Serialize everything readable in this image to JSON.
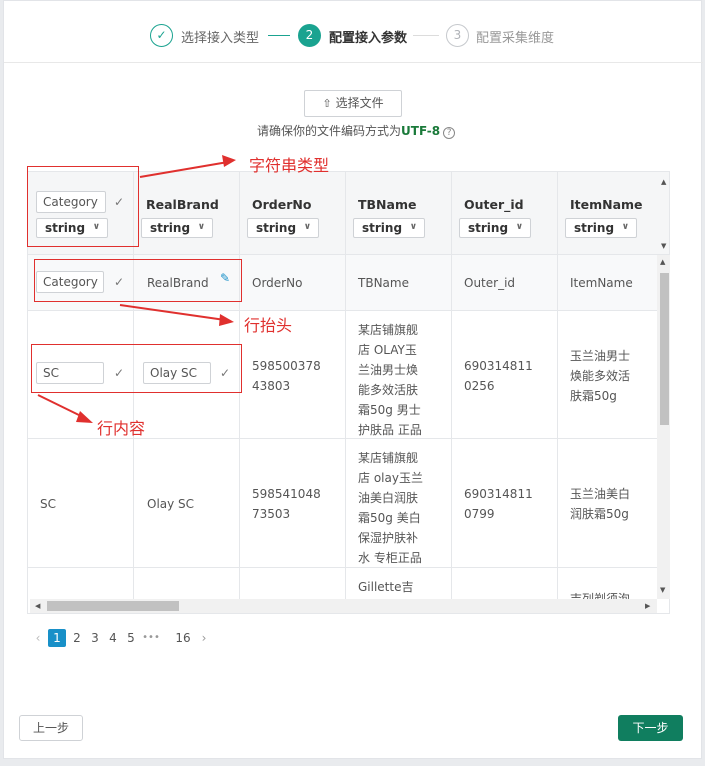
{
  "steps": [
    {
      "label": "选择接入类型",
      "number": "✓",
      "state": "done"
    },
    {
      "label": "配置接入参数",
      "number": "2",
      "state": "active"
    },
    {
      "label": "配置采集维度",
      "number": "3",
      "state": "wait"
    }
  ],
  "upload": {
    "label": "选择文件",
    "hint_prefix": "请确保你的文件编码方式为",
    "encoding": "UTF-8",
    "help": "?"
  },
  "table": {
    "columns": [
      {
        "name": "Category",
        "type": "string"
      },
      {
        "name": "RealBrand",
        "type": "string"
      },
      {
        "name": "OrderNo",
        "type": "string"
      },
      {
        "name": "TBName",
        "type": "string"
      },
      {
        "name": "Outer_id",
        "type": "string"
      },
      {
        "name": "ItemName",
        "type": "string"
      }
    ],
    "header_row": [
      "Category",
      "RealBrand",
      "OrderNo",
      "TBName",
      "Outer_id",
      "ItemName"
    ],
    "rows": [
      [
        "SC",
        "Olay SC",
        "598500378\n43803",
        "某店铺旗舰\n店 OLAY玉\n兰油男士焕\n能多效活肤\n霜50g 男士\n护肤品 正品",
        "690314811\n0256",
        "玉兰油男士\n焕能多效活\n肤霜50g"
      ],
      [
        "SC",
        "Olay SC",
        "598541048\n73503",
        "某店铺旗舰\n店 olay玉兰\n油美白润肤\n霜50g 美白\n保湿护肤补\n水 专柜正品",
        "690314811\n0799",
        "玉兰油美白\n润肤霜50g"
      ],
      [
        "",
        "",
        "",
        "Gillette吉",
        "",
        "吉列剃须泡"
      ]
    ]
  },
  "pagination": {
    "prev": "‹",
    "pages": [
      "1",
      "2",
      "3",
      "4",
      "5"
    ],
    "ellipsis": "•••",
    "last": "16",
    "next": "›",
    "current": "1"
  },
  "footer": {
    "prev_label": "上一步",
    "next_label": "下一步"
  },
  "annotations": {
    "type_label": "字符串类型",
    "header_label": "行抬头",
    "content_label": "行内容"
  },
  "colors": {
    "accent": "#1aa390",
    "primary_btn": "#107e5f",
    "annotation": "#e0302e",
    "page_active": "#1890c8"
  }
}
